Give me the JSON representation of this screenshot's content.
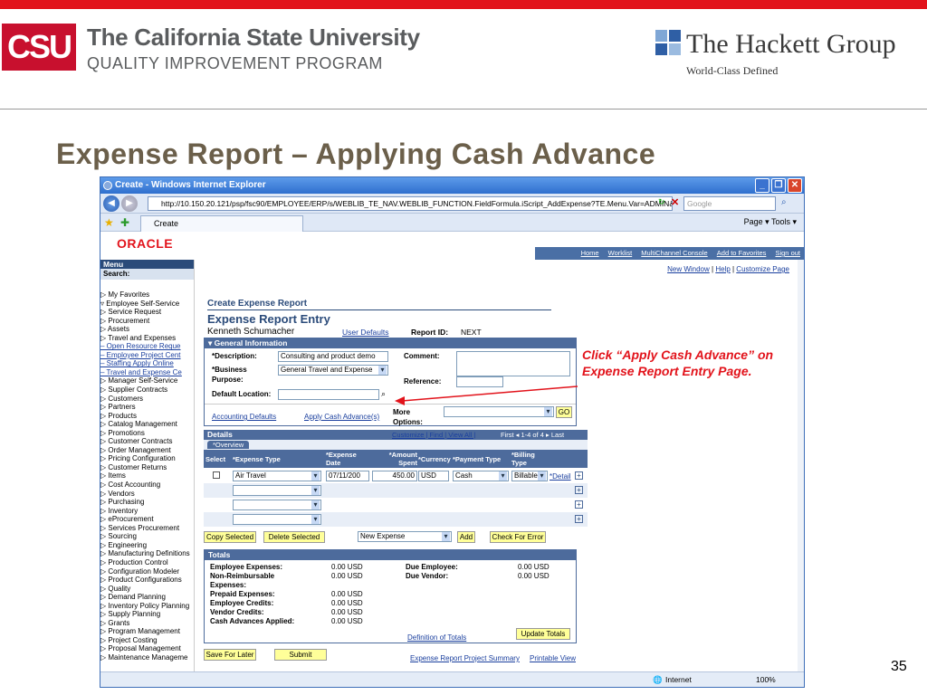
{
  "slide": {
    "csu_logo": "CSU",
    "csu_title": "The California State University",
    "csu_subtitle": "QUALITY IMPROVEMENT PROGRAM",
    "hackett_title": "The Hackett Group",
    "hackett_subtitle": "World-Class Defined",
    "title": "Expense Report – Applying Cash Advance",
    "annotation": "Click “Apply Cash Advance” on Expense Report Entry Page.",
    "page_number": "35"
  },
  "browser": {
    "window_title": "Create - Windows Internet Explorer",
    "url": "http://10.150.20.121/psp/fsc90/EMPLOYEE/ERP/s/WEBLIB_TE_NAV.WEBLIB_FUNCTION.FieldFormula.iScript_AddExpense?TE.Menu.Var=ADMIN&PORTALI",
    "search_placeholder": "Google",
    "tab_label": "Create",
    "tools_text": "Page ▾  Tools ▾",
    "status_zone": "Internet",
    "zoom": "100%"
  },
  "ps": {
    "logo": "ORACLE",
    "top_links": [
      "Home",
      "Worklist",
      "MultiChannel Console",
      "Add to Favorites",
      "Sign out"
    ],
    "sub_links": [
      "New Window",
      "Help",
      "Customize Page"
    ]
  },
  "menu": {
    "title": "Menu",
    "search_label": "Search:",
    "items": [
      "▷ My Favorites",
      "▿ Employee Self-Service",
      "   ▷ Service Request",
      "   ▷ Procurement",
      "   ▷ Assets",
      "   ▷ Travel and Expenses",
      "   – Open Resource Reque",
      "   – Employee Project Cent",
      "   – Staffing Apply Online",
      "   – Travel and Expense Ce",
      "▷ Manager Self-Service",
      "▷ Supplier Contracts",
      "▷ Customers",
      "▷ Partners",
      "▷ Products",
      "▷ Catalog Management",
      "▷ Promotions",
      "▷ Customer Contracts",
      "▷ Order Management",
      "▷ Pricing Configuration",
      "▷ Customer Returns",
      "▷ Items",
      "▷ Cost Accounting",
      "▷ Vendors",
      "▷ Purchasing",
      "▷ Inventory",
      "▷ eProcurement",
      "▷ Services Procurement",
      "▷ Sourcing",
      "▷ Engineering",
      "▷ Manufacturing Definitions",
      "▷ Production Control",
      "▷ Configuration Modeler",
      "▷ Product Configurations",
      "▷ Quality",
      "▷ Demand Planning",
      "▷ Inventory Policy Planning",
      "▷ Supply Planning",
      "▷ Grants",
      "▷ Program Management",
      "▷ Project Costing",
      "▷ Proposal Management",
      "▷ Maintenance Manageme"
    ]
  },
  "form": {
    "breadcrumb": "Create Expense Report",
    "heading": "Expense Report Entry",
    "employee": "Kenneth Schumacher",
    "user_defaults": "User Defaults",
    "report_id_label": "Report ID:",
    "report_id": "NEXT",
    "general_info": "▾ General Information",
    "description_label": "*Description:",
    "description_value": "Consulting and product demo",
    "business_purpose_label": "*Business Purpose:",
    "business_purpose_value": "General Travel and Expense",
    "comment_label": "Comment:",
    "reference_label": "Reference:",
    "default_location_label": "Default Location:",
    "accounting_defaults": "Accounting Defaults",
    "apply_cash_advance": "Apply Cash Advance(s)",
    "more_options_label": "More Options:",
    "go": "GO"
  },
  "details": {
    "title": "Details",
    "nav": "Customize | Find | View All |",
    "paging": "First ◂ 1-4 of 4 ▸ Last",
    "tab": "*Overview",
    "headers": [
      "Select",
      "*Expense Type",
      "*Expense Date",
      "*Amount Spent",
      "*Currency",
      "*Payment Type",
      "*Billing Type"
    ],
    "row1": {
      "expense_type": "Air Travel",
      "date": "07/11/200",
      "amount": "450.00",
      "currency": "USD",
      "payment": "Cash",
      "billing": "Billable",
      "detail": "*Detail"
    },
    "copy_selected": "Copy Selected",
    "delete_selected": "Delete Selected",
    "new_expense": "New Expense",
    "add": "Add",
    "check_errors": "Check For Error"
  },
  "totals": {
    "title": "Totals",
    "left": [
      {
        "label": "Employee Expenses:",
        "value": "0.00 USD"
      },
      {
        "label": "Non-Reimbursable Expenses:",
        "value": "0.00 USD"
      },
      {
        "label": "Prepaid Expenses:",
        "value": "0.00 USD"
      },
      {
        "label": "Employee Credits:",
        "value": "0.00 USD"
      },
      {
        "label": "Vendor Credits:",
        "value": "0.00 USD"
      },
      {
        "label": "Cash Advances Applied:",
        "value": "0.00 USD"
      }
    ],
    "right": [
      {
        "label": "Due Employee:",
        "value": "0.00 USD"
      },
      {
        "label": "Due Vendor:",
        "value": "0.00 USD"
      }
    ],
    "update": "Update Totals",
    "definition": "Definition of Totals",
    "save_later": "Save For Later",
    "submit": "Submit",
    "summary": "Expense Report Project Summary",
    "printable": "Printable View"
  }
}
